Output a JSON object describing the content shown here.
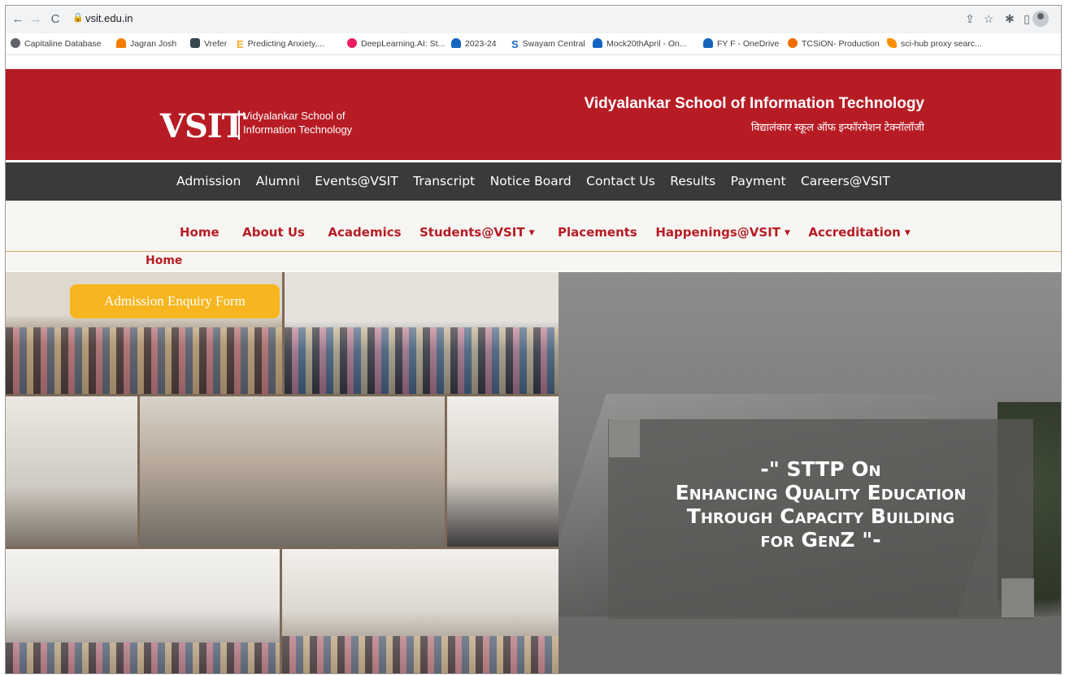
{
  "browser": {
    "url": "vsit.edu.in",
    "bookmarks": [
      {
        "label": "Capitaline Database",
        "color": "#5f6368"
      },
      {
        "label": "Jagran Josh",
        "color": "#f57c00"
      },
      {
        "label": "Vrefer",
        "color": "#37474f"
      },
      {
        "label": "Predicting Anxiety,...",
        "color": "#f9a825"
      },
      {
        "label": "DeepLearning.AI: St...",
        "color": "#e91e63"
      },
      {
        "label": "2023-24",
        "color": "#1565c0"
      },
      {
        "label": "Swayam Central",
        "color": "#1565c0"
      },
      {
        "label": "Mock20thApril - On...",
        "color": "#1565c0"
      },
      {
        "label": "FY F - OneDrive",
        "color": "#1565c0"
      },
      {
        "label": "TCSiON- Production",
        "color": "#ef6c00"
      },
      {
        "label": "sci-hub proxy searc...",
        "color": "#ff8f00"
      }
    ]
  },
  "header": {
    "logo_text": "VSIT",
    "logo_line1": "Vidyalankar School of",
    "logo_line2": "Information Technology",
    "title": "Vidyalankar School of Information Technology",
    "subtitle": "विद्यालंकार स्कूल ऑफ इन्फॉरमेशन टेक्नॉलॉजी",
    "brand_color": "#b71c25"
  },
  "top_nav": [
    "Admission",
    "Alumni",
    "Events@VSIT",
    "Transcript",
    "Notice Board",
    "Contact Us",
    "Results",
    "Payment",
    "Careers@VSIT"
  ],
  "main_nav": [
    {
      "label": "Home",
      "dropdown": false
    },
    {
      "label": "About Us",
      "dropdown": false
    },
    {
      "label": "Academics",
      "dropdown": false
    },
    {
      "label": "Students@VSIT",
      "dropdown": true
    },
    {
      "label": "Placements",
      "dropdown": false
    },
    {
      "label": "Happenings@VSIT",
      "dropdown": true
    },
    {
      "label": "Accreditation",
      "dropdown": true
    }
  ],
  "breadcrumb": "Home",
  "hero": {
    "enquiry_button": "Admission Enquiry Form",
    "caption_lines": [
      "-\" STTP  On",
      "Enhancing Quality Education",
      "Through Capacity Building",
      "for GenZ \"-"
    ]
  }
}
